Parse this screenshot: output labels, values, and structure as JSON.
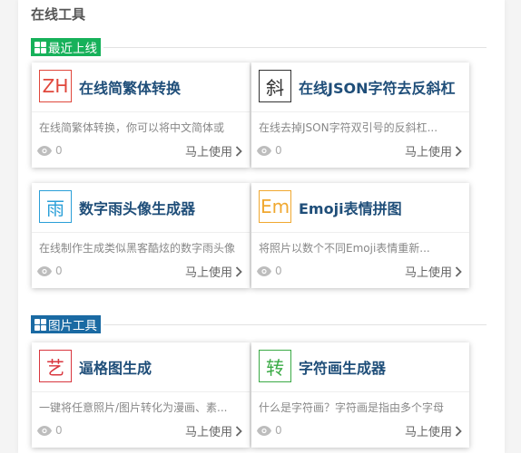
{
  "page_title": "在线工具",
  "colors": {
    "section_new": "#16b15a",
    "section_image": "#1a6aa3",
    "title": "#1f4e79"
  },
  "sections": [
    {
      "label": "最近上线"
    },
    {
      "label": "图片工具"
    }
  ],
  "common": {
    "use_label": "马上使用",
    "views_icon": "eye-icon",
    "arrow_icon": "chevron-right-icon"
  },
  "cards": [
    {
      "icon_text": "ZH",
      "icon_color": "#e0473c",
      "title": "在线简繁体转换",
      "desc": "在线简繁体转换，你可以将中文简体或",
      "views": "0"
    },
    {
      "icon_text": "斜",
      "icon_color": "#333333",
      "title": "在线JSON字符去反斜杠",
      "desc": "在线去掉JSON字符双引号的反斜杠...",
      "views": "0"
    },
    {
      "icon_text": "雨",
      "icon_color": "#2a9fd8",
      "title": "数字雨头像生成器",
      "desc": "在线制作生成类似黑客酷炫的数字雨头像",
      "views": "0"
    },
    {
      "icon_text": "Em",
      "icon_color": "#f0a830",
      "title": "Emoji表情拼图",
      "desc": "将照片以数个不同Emoji表情重新...",
      "views": "0"
    },
    {
      "icon_text": "艺",
      "icon_color": "#d9363e",
      "title": "逼格图生成",
      "desc": "一键将任意照片/图片转化为漫画、素...",
      "views": "0"
    },
    {
      "icon_text": "转",
      "icon_color": "#3aaa45",
      "title": "字符画生成器",
      "desc": "什么是字符画？字符画是指由多个字母",
      "views": "0"
    }
  ]
}
